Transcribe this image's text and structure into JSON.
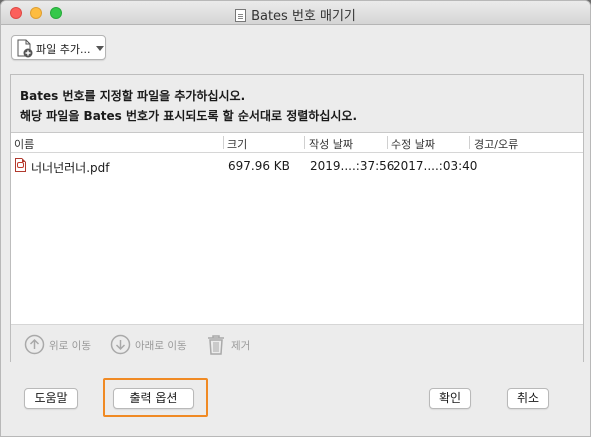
{
  "window": {
    "title": "Bates 번호 매기기"
  },
  "toolbar": {
    "add_files_label": "파일 추가..."
  },
  "instructions": {
    "line1": "Bates 번호를 지정할 파일을 추가하십시오.",
    "line2": "해당 파일을 Bates 번호가 표시되도록 할 순서대로 정렬하십시오."
  },
  "table": {
    "columns": [
      "이름",
      "크기",
      "작성 날짜",
      "수정 날짜",
      "경고/오류"
    ],
    "rows": [
      {
        "name": "너너넌러너.pdf",
        "size": "697.96 KB",
        "created": "2019....:37:56",
        "modified": "2017....:03:40",
        "warnings": ""
      }
    ]
  },
  "list_actions": {
    "move_up": "위로 이동",
    "move_down": "아래로 이동",
    "remove": "제거"
  },
  "buttons": {
    "help": "도움말",
    "output_options": "출력 옵션",
    "ok": "확인",
    "cancel": "취소"
  },
  "colors": {
    "highlight": "#f08a24"
  },
  "icons": [
    "document-icon",
    "add-file-icon",
    "pdf-file-icon",
    "move-up-icon",
    "move-down-icon",
    "trash-icon"
  ]
}
